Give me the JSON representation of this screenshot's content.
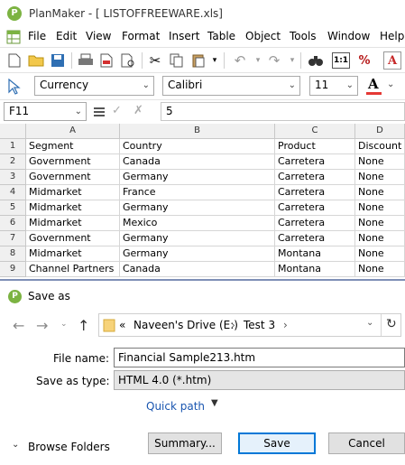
{
  "window": {
    "title": "PlanMaker - [ LISTOFFREEWARE.xls]"
  },
  "menu": [
    "File",
    "Edit",
    "View",
    "Format",
    "Insert",
    "Table",
    "Object",
    "Tools",
    "Window",
    "Help"
  ],
  "format_bar": {
    "number_format": "Currency",
    "font_name": "Calibri",
    "font_size": "11"
  },
  "formula_bar": {
    "cell_ref": "F11",
    "value": "5"
  },
  "sheet": {
    "columns": [
      "A",
      "B",
      "C",
      "D"
    ],
    "rows": [
      [
        "1",
        "Segment",
        "Country",
        "Product",
        "Discount B"
      ],
      [
        "2",
        "Government",
        "Canada",
        "Carretera",
        "None"
      ],
      [
        "3",
        "Government",
        "Germany",
        "Carretera",
        "None"
      ],
      [
        "4",
        "Midmarket",
        "France",
        "Carretera",
        "None"
      ],
      [
        "5",
        "Midmarket",
        "Germany",
        "Carretera",
        "None"
      ],
      [
        "6",
        "Midmarket",
        "Mexico",
        "Carretera",
        "None"
      ],
      [
        "7",
        "Government",
        "Germany",
        "Carretera",
        "None"
      ],
      [
        "8",
        "Midmarket",
        "Germany",
        "Montana",
        "None"
      ],
      [
        "9",
        "Channel Partners",
        "Canada",
        "Montana",
        "None"
      ]
    ]
  },
  "dialog": {
    "title": "Save as",
    "path": {
      "prefix": "«",
      "drive": "Naveen's Drive (E:)",
      "sep": "›",
      "folder": "Test 3"
    },
    "file_name_label": "File name:",
    "file_name": "Financial Sample213.htm",
    "save_type_label": "Save as type:",
    "save_type": "HTML 4.0 (*.htm)",
    "quick_path": "Quick path",
    "browse_folders": "Browse Folders",
    "summary_button": "Summary...",
    "save_button": "Save",
    "cancel_button": "Cancel"
  }
}
